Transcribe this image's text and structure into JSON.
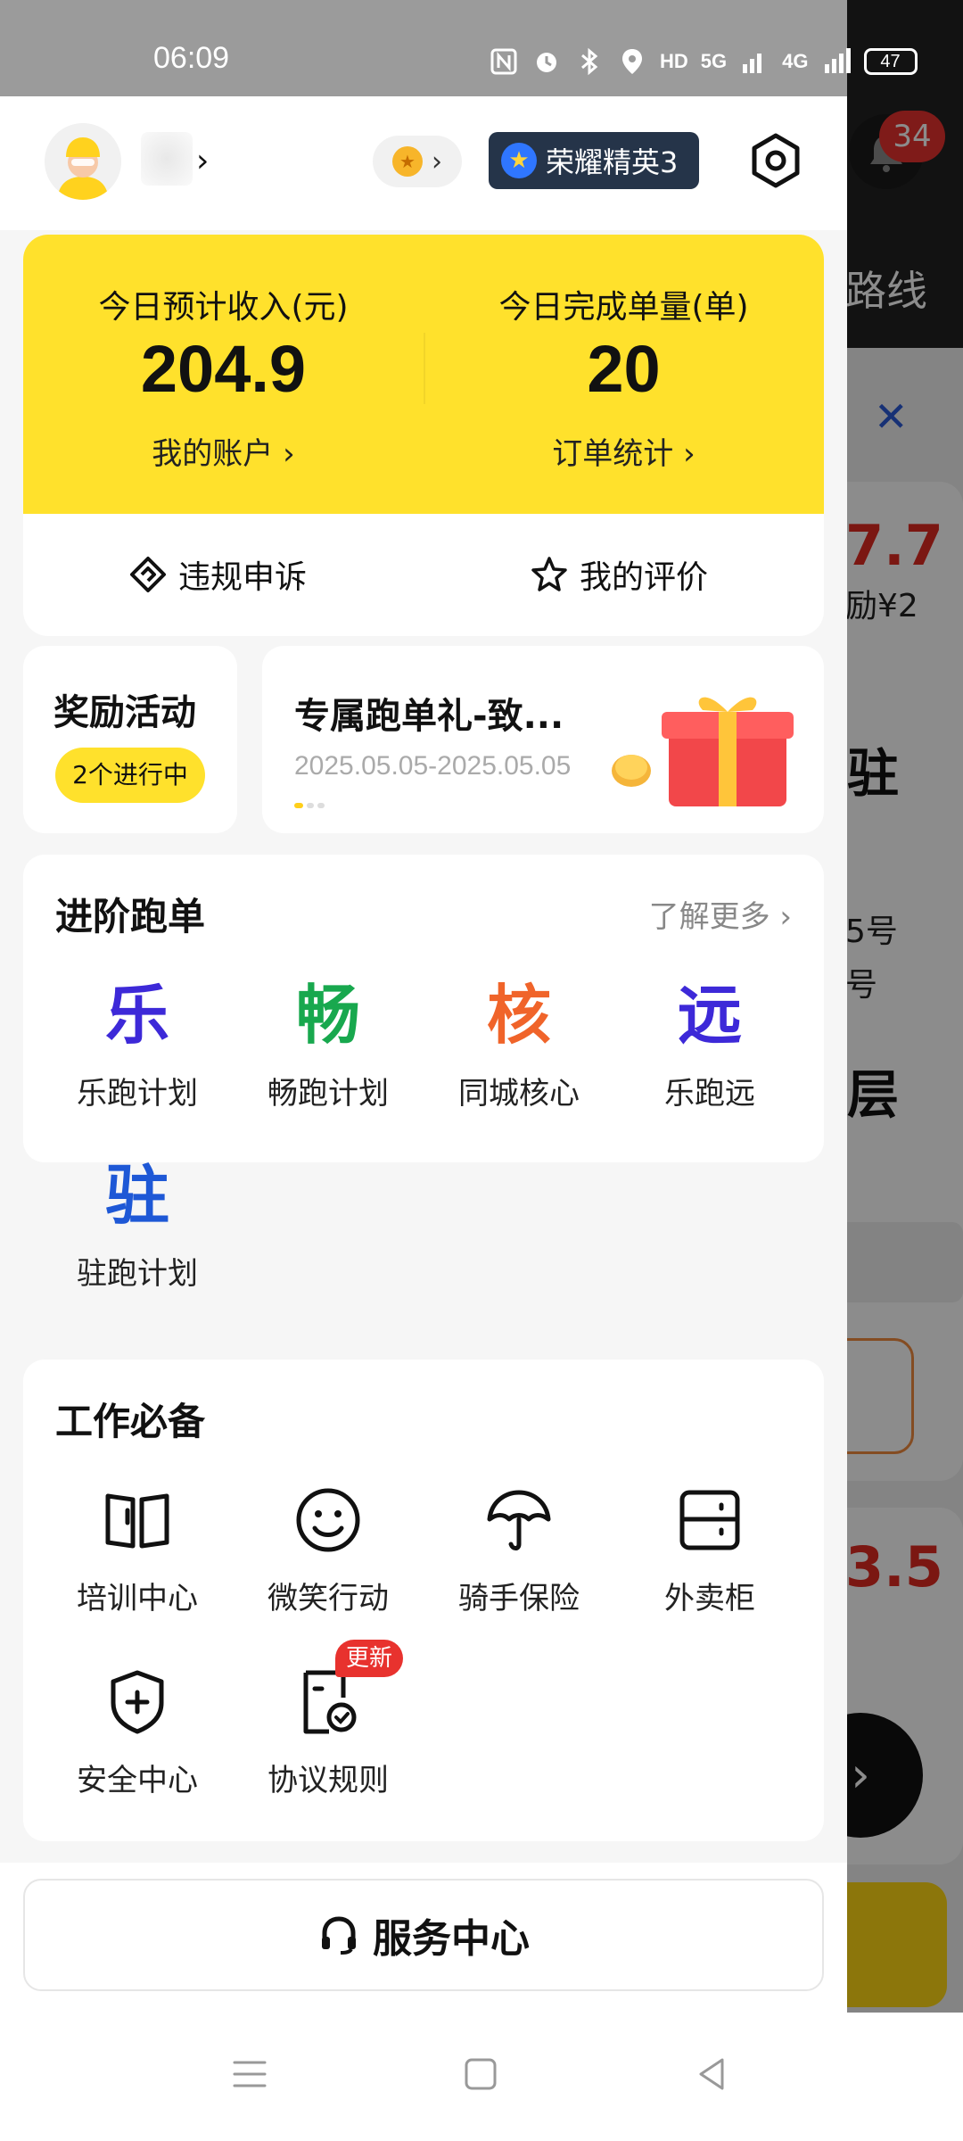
{
  "status_bar": {
    "time": "06:09",
    "hd_label": "HD",
    "net5g": "5G",
    "net4g": "4G",
    "battery": "47"
  },
  "background_app": {
    "notification_count": "34",
    "route_label": "路线",
    "price_1": "7.7",
    "reward_text": "励¥2",
    "big_char": "驻",
    "addr_1": "5号",
    "addr_2": "号",
    "floor_char": "层",
    "price_2": "3.5"
  },
  "drawer": {
    "username_chevron": "›",
    "rank_label": "荣耀精英3",
    "earnings": {
      "income_label": "今日预计收入(元)",
      "income_value": "204.9",
      "account_link": "我的账户",
      "orders_label": "今日完成单量(单)",
      "orders_value": "20",
      "stats_link": "订单统计"
    },
    "actions": {
      "appeal": "违规申诉",
      "reviews": "我的评价"
    },
    "rewards": {
      "title": "奖励活动",
      "status": "2个进行中"
    },
    "promo": {
      "title": "专属跑单礼-致...",
      "date_range": "2025.05.05-2025.05.05"
    },
    "advanced": {
      "title": "进阶跑单",
      "more": "了解更多",
      "items": [
        {
          "glyph": "乐",
          "label": "乐跑计划",
          "color": "#3d29d8"
        },
        {
          "glyph": "畅",
          "label": "畅跑计划",
          "color": "#18a84e"
        },
        {
          "glyph": "核",
          "label": "同城核心",
          "color": "#f0642a"
        },
        {
          "glyph": "远",
          "label": "乐跑远",
          "color": "#3d29d8"
        },
        {
          "glyph": "驻",
          "label": "驻跑计划",
          "color": "#1e58d6"
        }
      ]
    },
    "essentials": {
      "title": "工作必备",
      "items": [
        {
          "icon": "book-icon",
          "label": "培训中心"
        },
        {
          "icon": "smile-icon",
          "label": "微笑行动"
        },
        {
          "icon": "umbrella-icon",
          "label": "骑手保险"
        },
        {
          "icon": "locker-icon",
          "label": "外卖柜"
        },
        {
          "icon": "shield-plus-icon",
          "label": "安全中心"
        },
        {
          "icon": "agreement-icon",
          "label": "协议规则",
          "badge": "更新"
        }
      ]
    },
    "service_center": "服务中心"
  }
}
